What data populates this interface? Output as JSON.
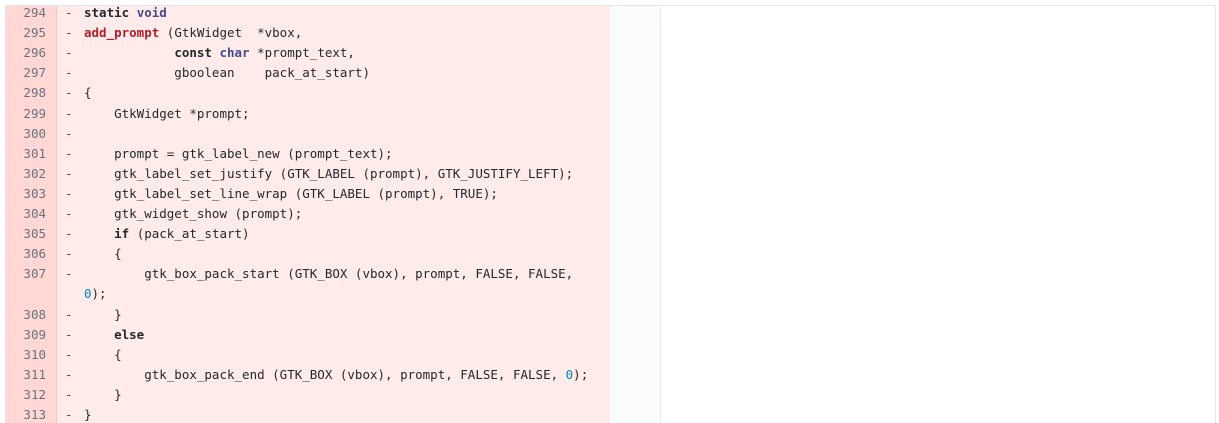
{
  "diff": {
    "lines": [
      {
        "num": "294",
        "sign": "-",
        "parts": [
          {
            "t": "static",
            "c": "kw"
          },
          {
            "t": " "
          },
          {
            "t": "void",
            "c": "ty"
          }
        ]
      },
      {
        "num": "295",
        "sign": "-",
        "parts": [
          {
            "t": "add_prompt",
            "c": "fn"
          },
          {
            "t": " (GtkWidget  *vbox,"
          }
        ]
      },
      {
        "num": "296",
        "sign": "-",
        "parts": [
          {
            "t": "            "
          },
          {
            "t": "const",
            "c": "kw"
          },
          {
            "t": " "
          },
          {
            "t": "char",
            "c": "ty"
          },
          {
            "t": " *prompt_text,"
          }
        ]
      },
      {
        "num": "297",
        "sign": "-",
        "parts": [
          {
            "t": "            gboolean    pack_at_start)"
          }
        ]
      },
      {
        "num": "298",
        "sign": "-",
        "parts": [
          {
            "t": "{"
          }
        ]
      },
      {
        "num": "299",
        "sign": "-",
        "parts": [
          {
            "t": "    GtkWidget *prompt;"
          }
        ]
      },
      {
        "num": "300",
        "sign": "-",
        "parts": [
          {
            "t": ""
          }
        ]
      },
      {
        "num": "301",
        "sign": "-",
        "parts": [
          {
            "t": "    prompt = gtk_label_new (prompt_text);"
          }
        ]
      },
      {
        "num": "302",
        "sign": "-",
        "parts": [
          {
            "t": "    gtk_label_set_justify (GTK_LABEL (prompt), GTK_JUSTIFY_LEFT);"
          }
        ]
      },
      {
        "num": "303",
        "sign": "-",
        "parts": [
          {
            "t": "    gtk_label_set_line_wrap (GTK_LABEL (prompt), TRUE);"
          }
        ]
      },
      {
        "num": "304",
        "sign": "-",
        "parts": [
          {
            "t": "    gtk_widget_show (prompt);"
          }
        ]
      },
      {
        "num": "305",
        "sign": "-",
        "parts": [
          {
            "t": "    "
          },
          {
            "t": "if",
            "c": "kw"
          },
          {
            "t": " (pack_at_start)"
          }
        ]
      },
      {
        "num": "306",
        "sign": "-",
        "parts": [
          {
            "t": "    {"
          }
        ]
      },
      {
        "num": "307",
        "sign": "-",
        "parts": [
          {
            "t": "        gtk_box_pack_start (GTK_BOX (vbox), prompt, FALSE, FALSE,"
          }
        ]
      },
      {
        "num": "",
        "sign": "",
        "parts": [
          {
            "t": "0",
            "c": "numlit"
          },
          {
            "t": ");"
          }
        ]
      },
      {
        "num": "308",
        "sign": "-",
        "parts": [
          {
            "t": "    }"
          }
        ]
      },
      {
        "num": "309",
        "sign": "-",
        "parts": [
          {
            "t": "    "
          },
          {
            "t": "else",
            "c": "kw"
          }
        ]
      },
      {
        "num": "310",
        "sign": "-",
        "parts": [
          {
            "t": "    {"
          }
        ]
      },
      {
        "num": "311",
        "sign": "-",
        "parts": [
          {
            "t": "        gtk_box_pack_end (GTK_BOX (vbox), prompt, FALSE, FALSE, "
          },
          {
            "t": "0",
            "c": "numlit"
          },
          {
            "t": ");"
          }
        ]
      },
      {
        "num": "312",
        "sign": "-",
        "parts": [
          {
            "t": "    }"
          }
        ]
      },
      {
        "num": "313",
        "sign": "-",
        "parts": [
          {
            "t": "}"
          }
        ]
      }
    ]
  }
}
